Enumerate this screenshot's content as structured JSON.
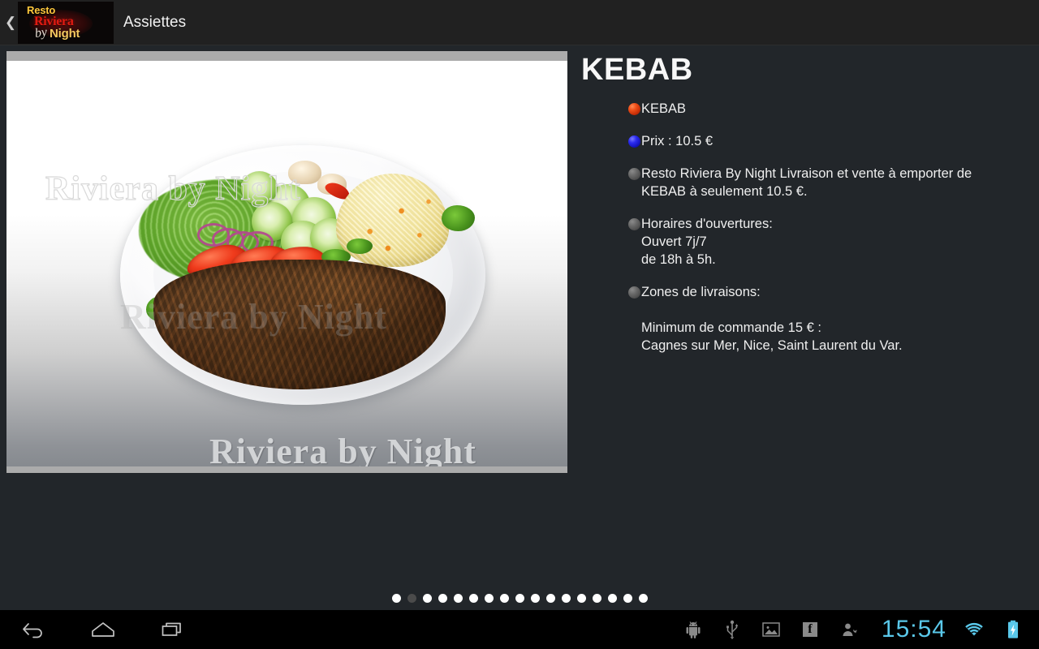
{
  "action_bar": {
    "back_icon": "chevron-left-icon",
    "logo": {
      "line1": "Resto",
      "line2": "Riviera",
      "line3_script": "by",
      "line3_word": "Night"
    },
    "title": "Assiettes"
  },
  "photo": {
    "watermark_top": "Riviera by Night",
    "watermark_mid": "Riviera by Night",
    "watermark_bottom": "Riviera by Night",
    "alt": "Assiette kebab avec riz, salade, tomates, concombre et oignons rouges"
  },
  "detail": {
    "title": "KEBAB",
    "bullets": [
      {
        "dot_color": "#ef5019",
        "dot_style": "red",
        "text": "KEBAB"
      },
      {
        "dot_color": "#2b2bf0",
        "dot_style": "blue",
        "text": "Prix : 10.5 €"
      },
      {
        "dot_color": "#6a6a6a",
        "dot_style": "gray",
        "text": "Resto Riviera By Night Livraison et vente à emporter de\nKEBAB à seulement 10.5 €."
      },
      {
        "dot_color": "#6a6a6a",
        "dot_style": "gray",
        "text": "Horaires d'ouvertures:\nOuvert 7j/7\nde 18h à 5h."
      },
      {
        "dot_color": "#6a6a6a",
        "dot_style": "gray",
        "text": "Zones de livraisons:"
      }
    ],
    "notes": "Minimum de commande 15 € :\nCagnes sur Mer, Nice, Saint Laurent du Var."
  },
  "pager": {
    "total": 17,
    "current_index": 1
  },
  "system_bar": {
    "nav": [
      {
        "name": "back-button",
        "icon": "back-arrow-icon"
      },
      {
        "name": "home-button",
        "icon": "home-icon"
      },
      {
        "name": "recents-button",
        "icon": "recent-apps-icon"
      }
    ],
    "status_icons": [
      {
        "name": "android-debug-icon",
        "glyph": "android"
      },
      {
        "name": "usb-icon",
        "glyph": "usb"
      },
      {
        "name": "gallery-notification-icon",
        "glyph": "image"
      },
      {
        "name": "facebook-notification-icon",
        "glyph": "f"
      },
      {
        "name": "contacts-notification-icon",
        "glyph": "person"
      }
    ],
    "clock": "15:54",
    "wifi_icon": "wifi-icon",
    "battery_icon": "battery-charging-icon",
    "accent_color": "#5ac8ea"
  }
}
